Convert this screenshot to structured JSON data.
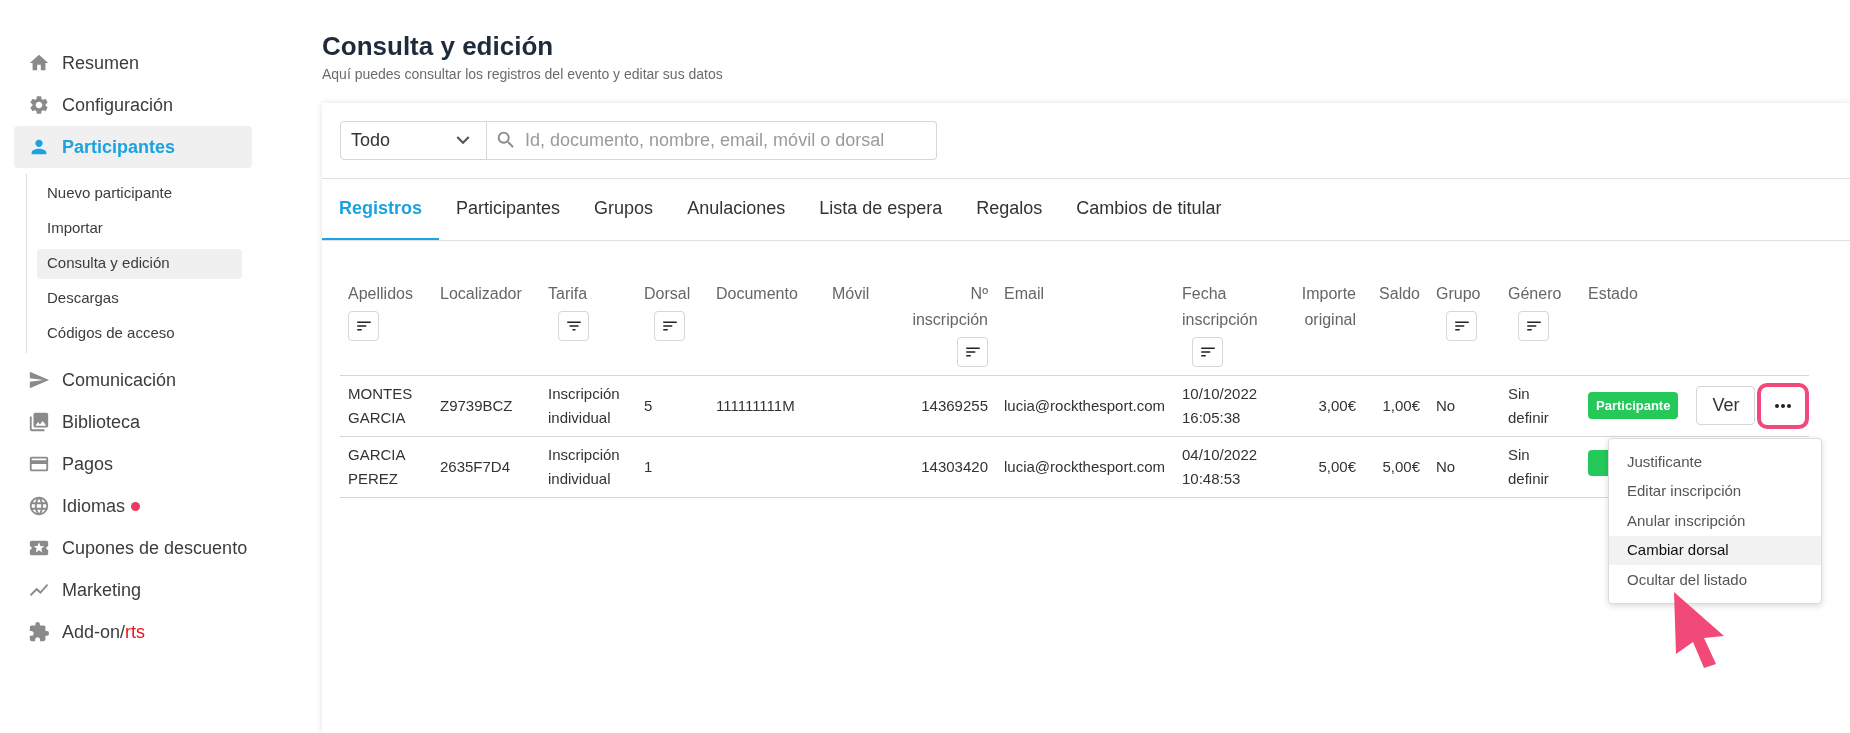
{
  "sidebar": {
    "items": [
      {
        "label": "Resumen",
        "selected": false
      },
      {
        "label": "Configuración",
        "selected": false
      },
      {
        "label": "Participantes",
        "selected": true,
        "children": [
          {
            "label": "Nuevo participante",
            "selected": false
          },
          {
            "label": "Importar",
            "selected": false
          },
          {
            "label": "Consulta y edición",
            "selected": true
          },
          {
            "label": "Descargas",
            "selected": false
          },
          {
            "label": "Códigos de acceso",
            "selected": false
          }
        ]
      },
      {
        "label": "Comunicación",
        "selected": false
      },
      {
        "label": "Biblioteca",
        "selected": false
      },
      {
        "label": "Pagos",
        "selected": false
      },
      {
        "label": "Idiomas",
        "selected": false,
        "dot": true
      },
      {
        "label": "Cupones de descuento",
        "selected": false
      },
      {
        "label": "Marketing",
        "selected": false
      },
      {
        "label": "Add-on/",
        "accent": "rts",
        "selected": false
      }
    ]
  },
  "header": {
    "title": "Consulta y edición",
    "subtitle": "Aquí puedes consultar los registros del evento y editar sus datos"
  },
  "filter": {
    "scope": "Todo",
    "search_placeholder": "Id, documento, nombre, email, móvil o dorsal"
  },
  "tabs": [
    {
      "label": "Registros",
      "selected": true
    },
    {
      "label": "Participantes",
      "selected": false
    },
    {
      "label": "Grupos",
      "selected": false
    },
    {
      "label": "Anulaciones",
      "selected": false
    },
    {
      "label": "Lista de espera",
      "selected": false
    },
    {
      "label": "Regalos",
      "selected": false
    },
    {
      "label": "Cambios de titular",
      "selected": false
    }
  ],
  "table": {
    "columns": [
      {
        "label": "Apellidos",
        "kind": "sort"
      },
      {
        "label": "Localizador",
        "kind": "plain"
      },
      {
        "label": "Tarifa",
        "kind": "filter"
      },
      {
        "label": "Dorsal",
        "kind": "sort"
      },
      {
        "label": "Documento",
        "kind": "plain"
      },
      {
        "label": "Móvil",
        "kind": "plain"
      },
      {
        "label": "Nº inscripción",
        "kind": "sort"
      },
      {
        "label": "Email",
        "kind": "plain"
      },
      {
        "label": "Fecha inscripción",
        "kind": "sort"
      },
      {
        "label": "Importe original",
        "kind": "plain"
      },
      {
        "label": "Saldo",
        "kind": "plain"
      },
      {
        "label": "Grupo",
        "kind": "sort"
      },
      {
        "label": "Género",
        "kind": "sort"
      },
      {
        "label": "Estado",
        "kind": "plain"
      }
    ],
    "rows": [
      {
        "cells": [
          "MONTES GARCIA",
          "Z9739BCZ",
          "Inscripción individual",
          "5",
          "111111111M",
          null,
          "14369255",
          "lucia@rockthesport.com",
          "10/10/2022 16:05:38",
          "3,00€",
          "1,00€",
          "No",
          "Sin definir"
        ],
        "status": "Participante",
        "view": "Ver",
        "more_highlighted": true
      },
      {
        "cells": [
          "GARCIA PEREZ",
          "2635F7D4",
          "Inscripción individual",
          "1",
          null,
          null,
          "14303420",
          "lucia@rockthesport.com",
          "04/10/2022 10:48:53",
          "5,00€",
          "5,00€",
          "No",
          "Sin definir"
        ],
        "status_partial": true
      }
    ]
  },
  "menu": {
    "items": [
      {
        "label": "Justificante",
        "selected": false
      },
      {
        "label": "Editar inscripción",
        "selected": false
      },
      {
        "label": "Anular inscripción",
        "selected": false
      },
      {
        "label": "Cambiar dorsal",
        "selected": true
      },
      {
        "label": "Ocultar del listado",
        "selected": false
      }
    ]
  }
}
